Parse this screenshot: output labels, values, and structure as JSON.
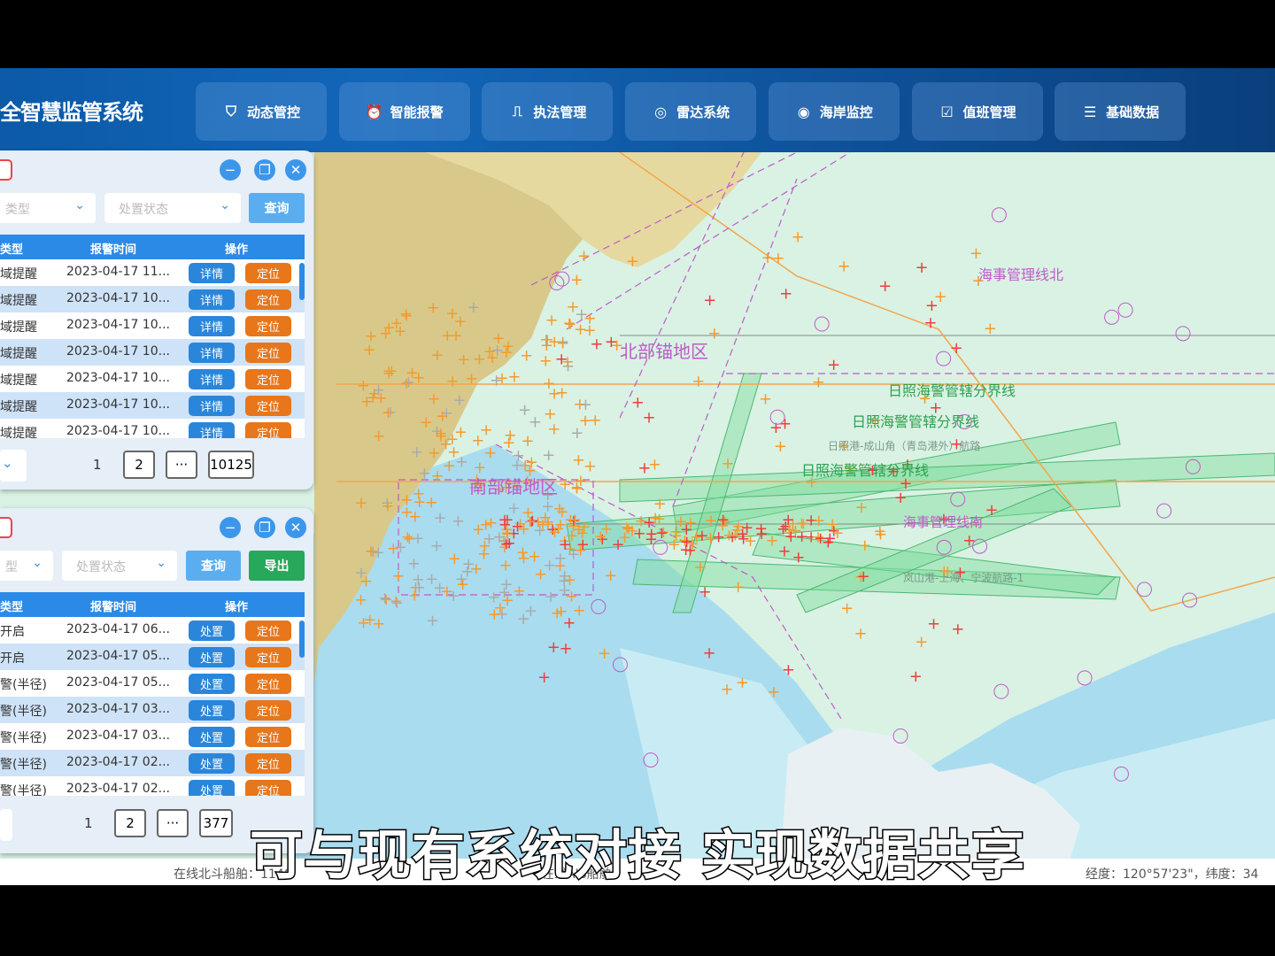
{
  "header": {
    "title": "全智慧监管系统",
    "nav": [
      {
        "label": "动态管控",
        "icon": "shield-check-icon"
      },
      {
        "label": "智能报警",
        "icon": "alarm-icon"
      },
      {
        "label": "执法管理",
        "icon": "stamp-icon"
      },
      {
        "label": "雷达系统",
        "icon": "radar-icon"
      },
      {
        "label": "海岸监控",
        "icon": "camera-icon"
      },
      {
        "label": "值班管理",
        "icon": "clipboard-check-icon"
      },
      {
        "label": "基础数据",
        "icon": "database-icon"
      }
    ]
  },
  "panel1": {
    "filter1": "类型",
    "filter2": "处置状态",
    "query": "查询",
    "columns": [
      "类型",
      "报警时间",
      "操作"
    ],
    "rows": [
      {
        "type": "域提醒",
        "time": "2023-04-17 11...",
        "a": "详情",
        "b": "定位"
      },
      {
        "type": "域提醒",
        "time": "2023-04-17 10...",
        "a": "详情",
        "b": "定位"
      },
      {
        "type": "域提醒",
        "time": "2023-04-17 10...",
        "a": "详情",
        "b": "定位"
      },
      {
        "type": "域提醒",
        "time": "2023-04-17 10...",
        "a": "详情",
        "b": "定位"
      },
      {
        "type": "域提醒",
        "time": "2023-04-17 10...",
        "a": "详情",
        "b": "定位"
      },
      {
        "type": "域提醒",
        "time": "2023-04-17 10...",
        "a": "详情",
        "b": "定位"
      },
      {
        "type": "域提醒",
        "time": "2023-04-17 10...",
        "a": "详情",
        "b": "定位"
      }
    ],
    "pager": {
      "current": "1",
      "next": "2",
      "ellipsis": "···",
      "last": "10125"
    }
  },
  "panel2": {
    "filter1": "型",
    "filter2": "处置状态",
    "query": "查询",
    "export": "导出",
    "columns": [
      "类型",
      "报警时间",
      "操作"
    ],
    "rows": [
      {
        "type": "开启",
        "time": "2023-04-17 06...",
        "a": "处置",
        "b": "定位"
      },
      {
        "type": "开启",
        "time": "2023-04-17 05...",
        "a": "处置",
        "b": "定位"
      },
      {
        "type": "警(半径)",
        "time": "2023-04-17 05...",
        "a": "处置",
        "b": "定位"
      },
      {
        "type": "警(半径)",
        "time": "2023-04-17 03...",
        "a": "处置",
        "b": "定位"
      },
      {
        "type": "警(半径)",
        "time": "2023-04-17 03...",
        "a": "处置",
        "b": "定位"
      },
      {
        "type": "警(半径)",
        "time": "2023-04-17 02...",
        "a": "处置",
        "b": "定位"
      },
      {
        "type": "警(半径)",
        "time": "2023-04-17 02...",
        "a": "处置",
        "b": "定位"
      }
    ],
    "pager": {
      "current": "1",
      "next": "2",
      "ellipsis": "···",
      "last": "377"
    }
  },
  "map": {
    "labels": {
      "north_line": "海事管理线北",
      "border1": "日照海警管辖分界线",
      "border2": "日照海警管辖分界线",
      "border3": "日照海警管辖分界线",
      "route1": "日照港-成山角（青岛港外）航路",
      "south_line": "海事管理线南",
      "route2": "岚山港-上海、宁波航路-1",
      "zone1": "北部锚地区",
      "zone2": "南部锚地区"
    },
    "colors": {
      "land": "#d8c98a",
      "sea_shallow": "#a9dcef",
      "sea": "#d9f2e4",
      "lane": "#7fdc9c",
      "vessel_orange": "#f59a2c",
      "vessel_red": "#f03c3c",
      "boundary": "#c05ac8"
    }
  },
  "status": {
    "beidou": "在线北斗船舶：1140",
    "ais": "在线AIS船舶：",
    "coords": "经度：120°57'23\"，纬度：34"
  },
  "caption": "可与现有系统对接 实现数据共享"
}
